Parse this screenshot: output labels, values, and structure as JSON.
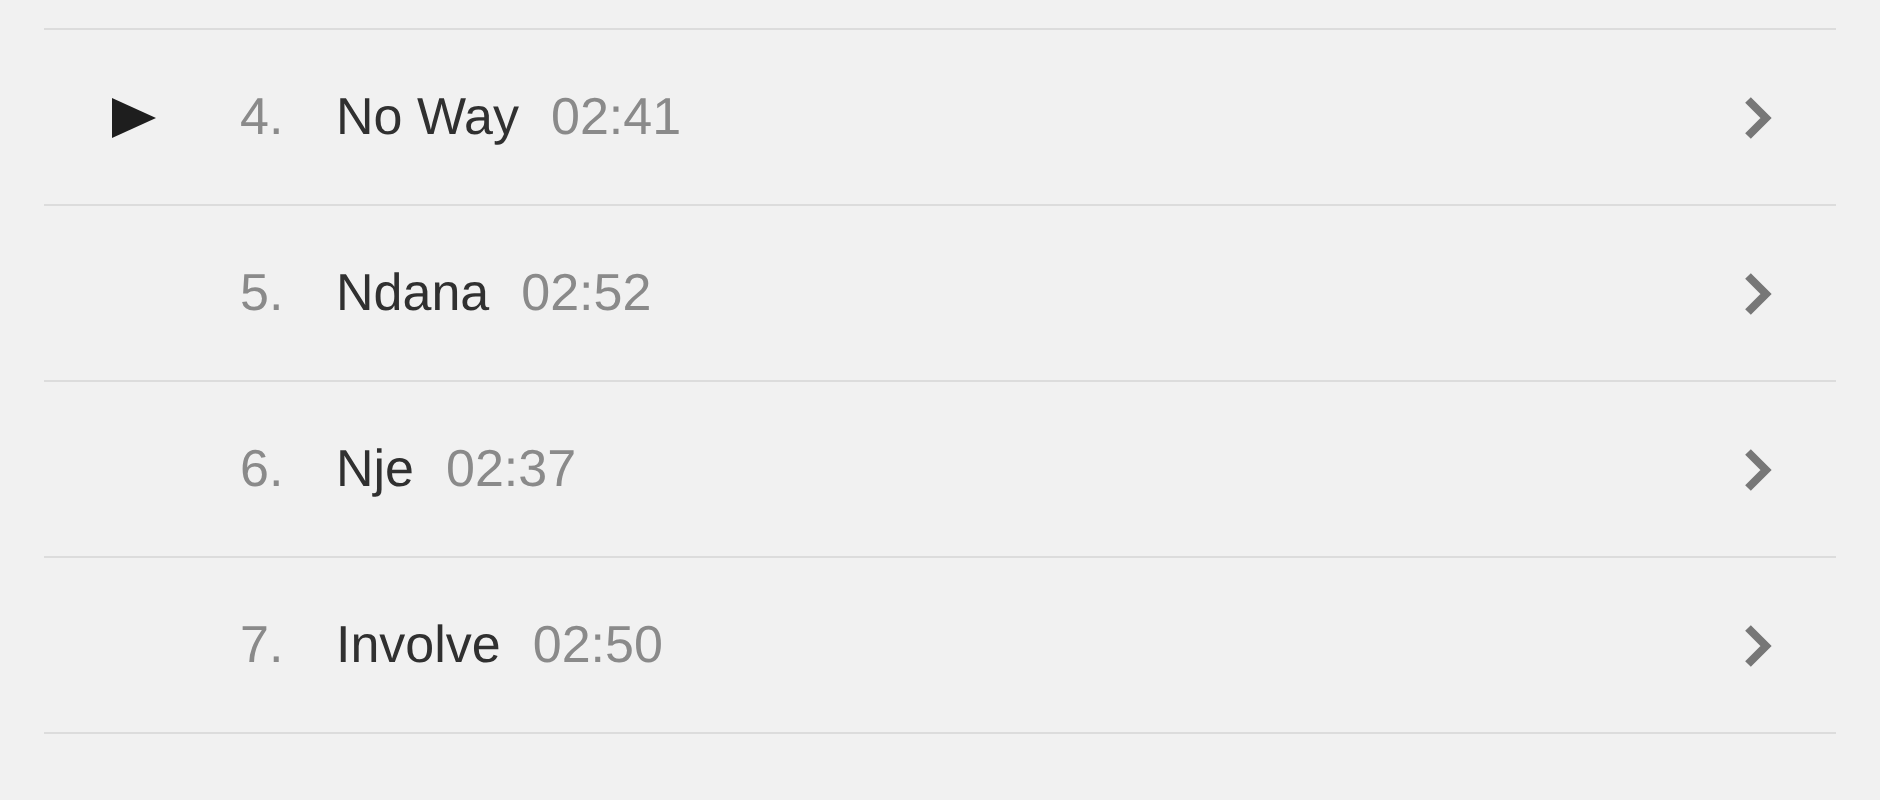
{
  "tracks": [
    {
      "number": "4.",
      "title": "No Way",
      "duration": "02:41",
      "playing": true
    },
    {
      "number": "5.",
      "title": "Ndana",
      "duration": "02:52",
      "playing": false
    },
    {
      "number": "6.",
      "title": "Nje",
      "duration": "02:37",
      "playing": false
    },
    {
      "number": "7.",
      "title": "Involve",
      "duration": "02:50",
      "playing": false
    }
  ]
}
